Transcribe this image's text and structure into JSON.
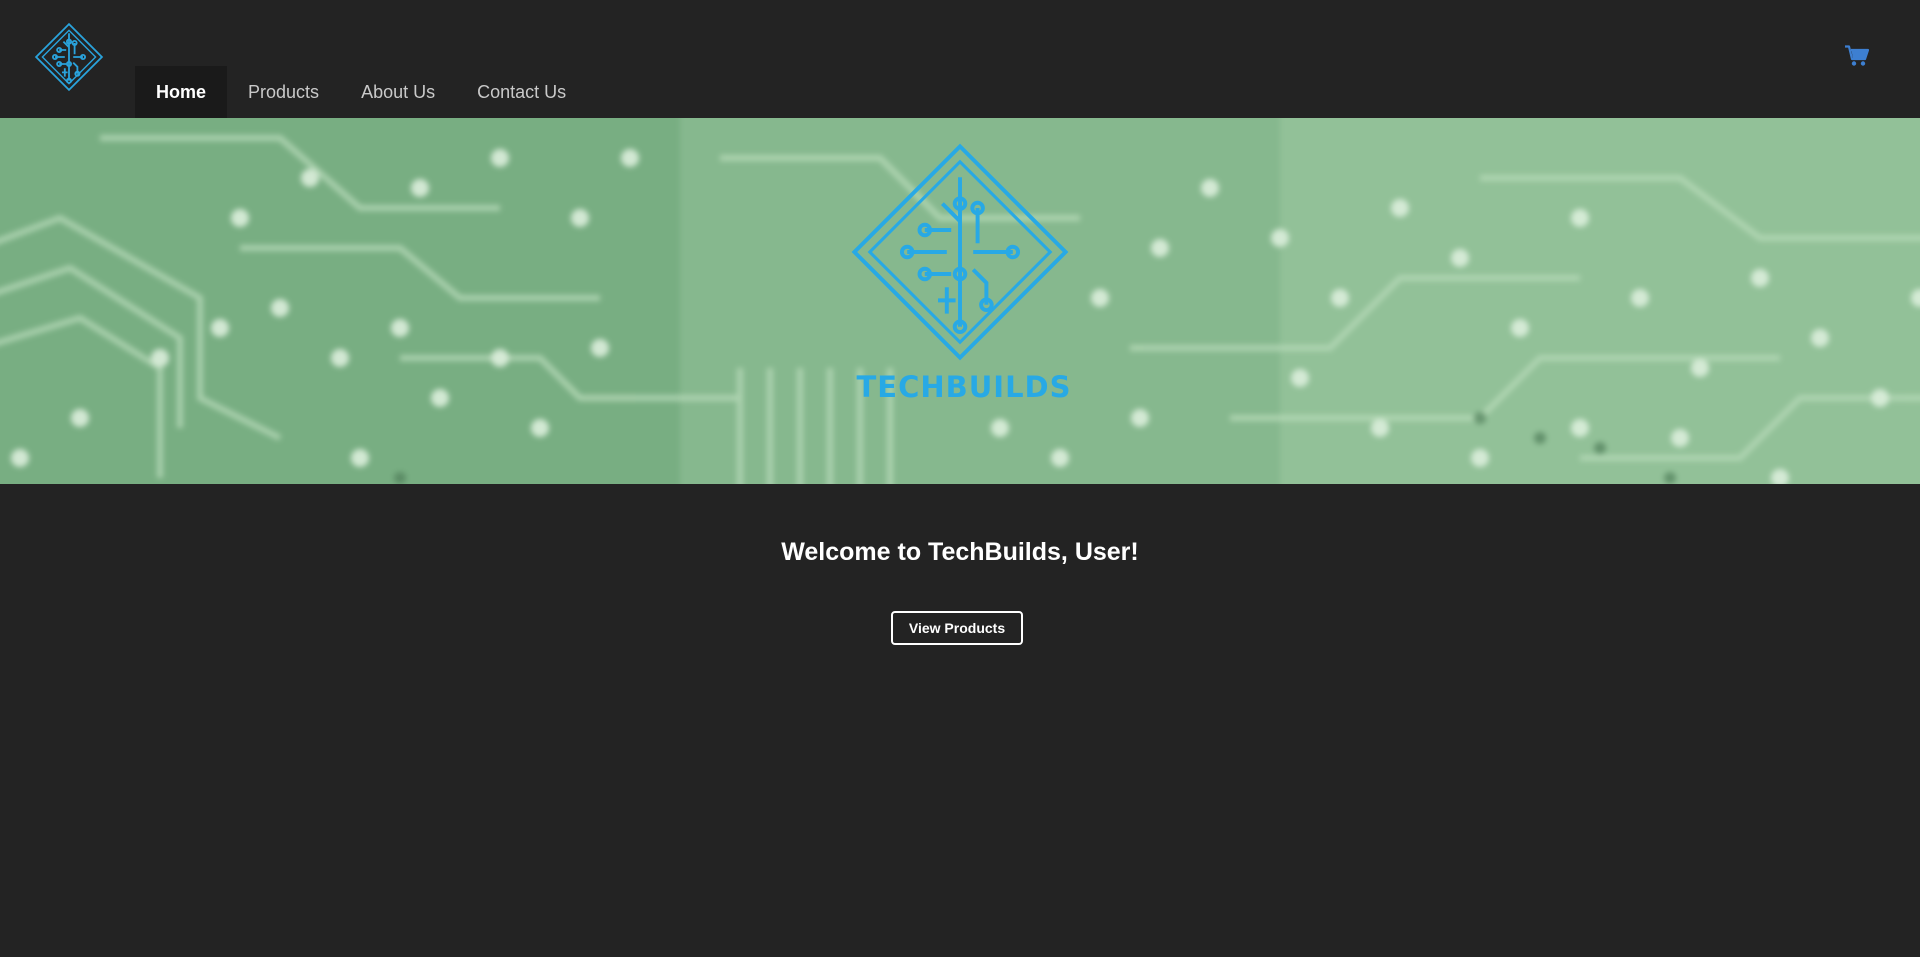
{
  "header": {
    "logo_icon": "techbuilds-circuit-diamond-icon",
    "nav": [
      {
        "label": "Home",
        "active": true
      },
      {
        "label": "Products",
        "active": false
      },
      {
        "label": "About Us",
        "active": false
      },
      {
        "label": "Contact Us",
        "active": false
      }
    ],
    "cart_icon": "shopping-cart-icon"
  },
  "hero": {
    "background": "blurred-green-circuit-board-image",
    "logo_icon": "techbuilds-circuit-diamond-icon",
    "wordmark": "TECHBUILDS"
  },
  "main": {
    "welcome": "Welcome to TechBuilds, User!",
    "view_products_label": "View Products"
  },
  "colors": {
    "background": "#232323",
    "accent": "#28a9e5",
    "cart": "#3d7fd1",
    "hero_green": "#8bbd92"
  }
}
